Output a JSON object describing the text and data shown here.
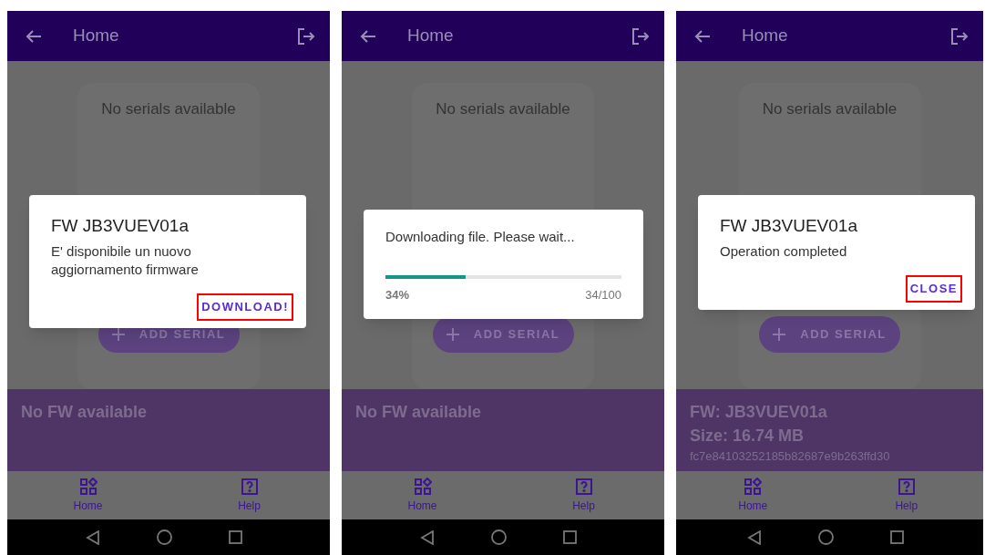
{
  "screens": [
    {
      "app_bar": {
        "title": "Home"
      },
      "serials_card": {
        "message": "No serials available",
        "add_button": "ADD SERIAL"
      },
      "fw_panel": {
        "lines": [
          {
            "kind": "title",
            "text": "No FW available"
          }
        ]
      },
      "bottom_nav": [
        {
          "label": "Home",
          "kind": "home"
        },
        {
          "label": "Help",
          "kind": "help"
        }
      ],
      "dialog": {
        "kind": "message",
        "title": "FW JB3VUEV01a",
        "body": "E' disponibile un nuovo aggiornamento firmware",
        "action": {
          "label": "DOWNLOAD!",
          "highlighted": true
        }
      }
    },
    {
      "app_bar": {
        "title": "Home"
      },
      "serials_card": {
        "message": "No serials available",
        "add_button": "ADD SERIAL"
      },
      "fw_panel": {
        "lines": [
          {
            "kind": "title",
            "text": "No FW available"
          }
        ]
      },
      "bottom_nav": [
        {
          "label": "Home",
          "kind": "home"
        },
        {
          "label": "Help",
          "kind": "help"
        }
      ],
      "dialog": {
        "kind": "progress",
        "body": "Downloading file. Please wait...",
        "level": 0.34,
        "percent": "34%",
        "count": "34/100"
      }
    },
    {
      "app_bar": {
        "title": "Home"
      },
      "serials_card": {
        "message": "No serials available",
        "add_button": "ADD SERIAL"
      },
      "fw_panel": {
        "lines": [
          {
            "kind": "title",
            "text": "FW: JB3VUEV01a"
          },
          {
            "kind": "title",
            "text": "Size: 16.74 MB"
          },
          {
            "kind": "hash",
            "text": "fc7e84103252185b82687e9b263ffd30"
          }
        ]
      },
      "bottom_nav": [
        {
          "label": "Home",
          "kind": "home"
        },
        {
          "label": "Help",
          "kind": "help"
        }
      ],
      "dialog": {
        "kind": "message",
        "title": "FW JB3VUEV01a",
        "body": "Operation completed",
        "action": {
          "label": "CLOSE",
          "highlighted": true
        }
      }
    }
  ]
}
